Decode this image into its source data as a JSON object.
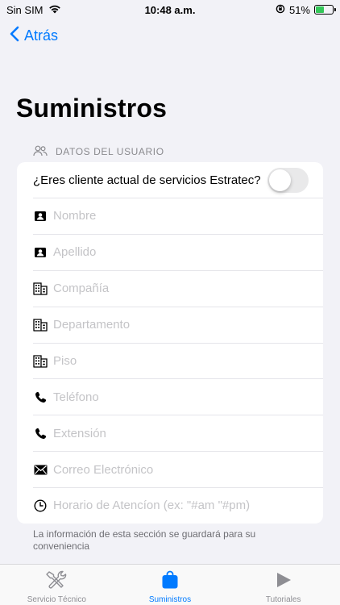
{
  "status_bar": {
    "carrier": "Sin SIM",
    "time": "10:48 a.m.",
    "battery": "51%",
    "battery_level": 0.51,
    "battery_color": "#34c759"
  },
  "nav": {
    "back_label": "Atrás"
  },
  "page": {
    "title": "Suministros"
  },
  "section": {
    "header": "DATOS DEL USUARIO",
    "header_icon": "people-icon",
    "toggle_label": "¿Eres cliente actual de servicios Estratec?",
    "toggle_on": false,
    "fields": [
      {
        "icon": "person-card-icon",
        "placeholder": "Nombre",
        "value": ""
      },
      {
        "icon": "person-card-icon",
        "placeholder": "Apellido",
        "value": ""
      },
      {
        "icon": "building-icon",
        "placeholder": "Compañía",
        "value": ""
      },
      {
        "icon": "building-icon",
        "placeholder": "Departamento",
        "value": ""
      },
      {
        "icon": "building-icon",
        "placeholder": "Piso",
        "value": ""
      },
      {
        "icon": "phone-icon",
        "placeholder": "Teléfono",
        "value": ""
      },
      {
        "icon": "phone-icon",
        "placeholder": "Extensión",
        "value": ""
      },
      {
        "icon": "envelope-icon",
        "placeholder": "Correo Electrónico",
        "value": ""
      },
      {
        "icon": "clock-icon",
        "placeholder": "Horario de Atencíon (ex: \"#am \"#pm)",
        "value": ""
      }
    ],
    "footer": "La información de esta sección se guardará para su conveniencia"
  },
  "tab_bar": {
    "tabs": [
      {
        "label": "Servicio Técnico",
        "icon": "tools-icon",
        "active": false
      },
      {
        "label": "Suministros",
        "icon": "bag-icon",
        "active": true
      },
      {
        "label": "Tutoriales",
        "icon": "play-icon",
        "active": false
      }
    ]
  },
  "colors": {
    "accent": "#007aff",
    "background": "#f2f2f7",
    "placeholder": "#c4c4c7"
  }
}
